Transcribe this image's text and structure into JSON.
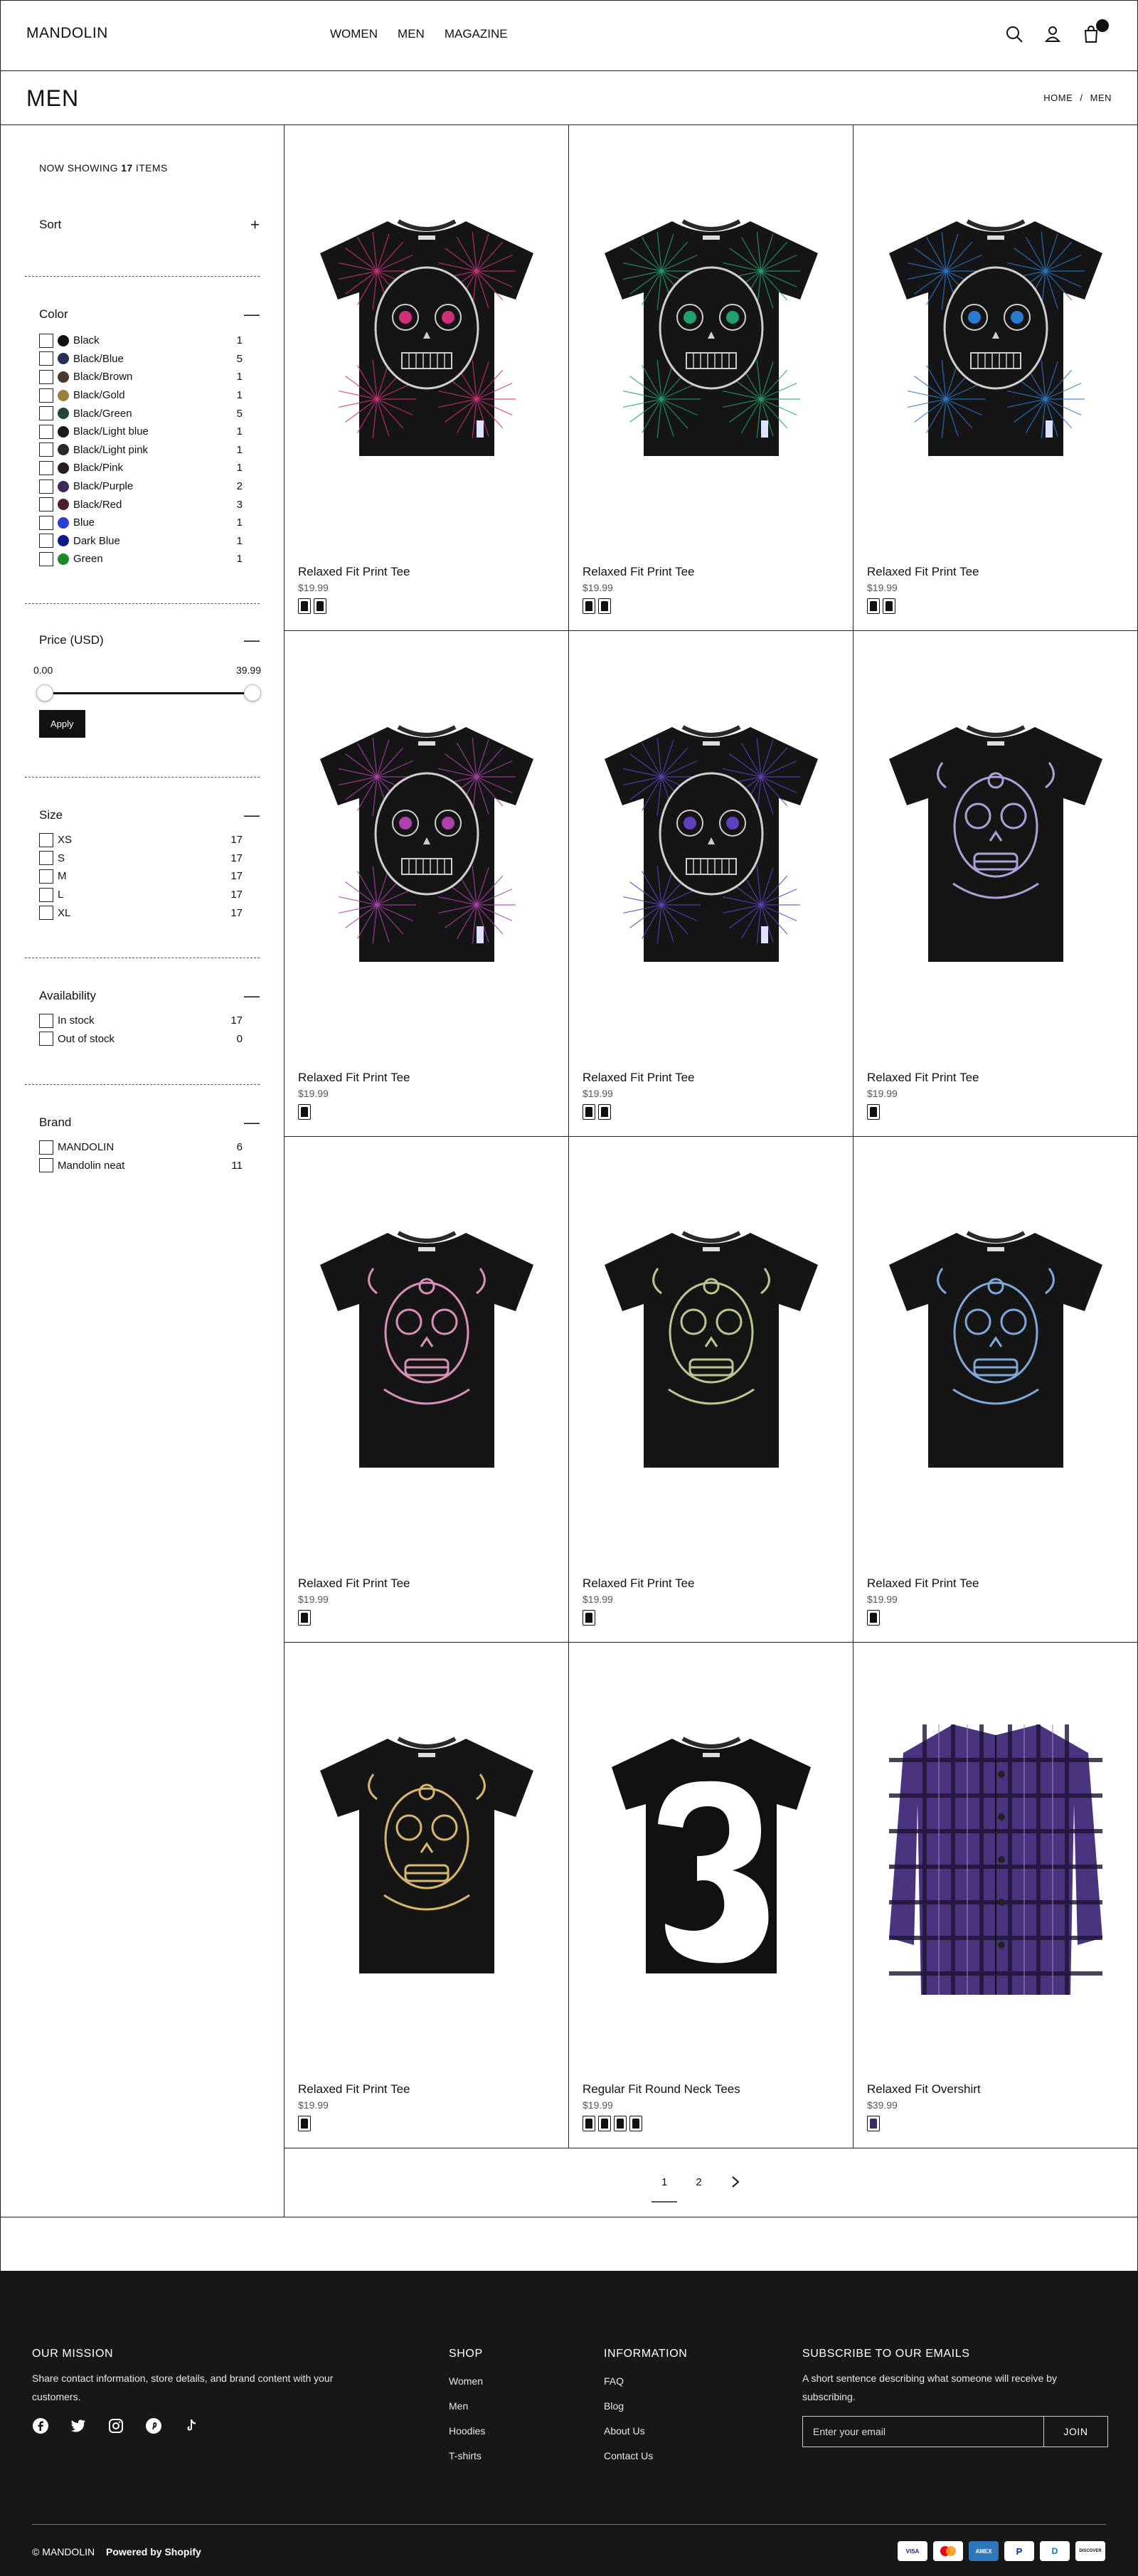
{
  "header": {
    "logo": "MANDOLIN",
    "nav": [
      "WOMEN",
      "MEN",
      "MAGAZINE"
    ]
  },
  "title_bar": {
    "title": "MEN",
    "breadcrumb": [
      "HOME",
      "/",
      "MEN"
    ]
  },
  "sidebar": {
    "showing_prefix": "NOW SHOWING",
    "showing_count": "17",
    "showing_suffix": "ITEMS",
    "sort_label": "Sort",
    "color": {
      "label": "Color",
      "options": [
        {
          "name": "Black",
          "count": "1",
          "swatch": "#111111"
        },
        {
          "name": "Black/Blue",
          "count": "5",
          "swatch": "#2a2f5a"
        },
        {
          "name": "Black/Brown",
          "count": "1",
          "swatch": "#4a3a2a"
        },
        {
          "name": "Black/Gold",
          "count": "1",
          "swatch": "#9a8040"
        },
        {
          "name": "Black/Green",
          "count": "5",
          "swatch": "#22463a"
        },
        {
          "name": "Black/Light blue",
          "count": "1",
          "swatch": "#1a1a1a"
        },
        {
          "name": "Black/Light pink",
          "count": "1",
          "swatch": "#2a2a2a"
        },
        {
          "name": "Black/Pink",
          "count": "1",
          "swatch": "#2a1a22"
        },
        {
          "name": "Black/Purple",
          "count": "2",
          "swatch": "#3a2a55"
        },
        {
          "name": "Black/Red",
          "count": "3",
          "swatch": "#4a2030"
        },
        {
          "name": "Blue",
          "count": "1",
          "swatch": "#2a3fd8"
        },
        {
          "name": "Dark Blue",
          "count": "1",
          "swatch": "#121a8a"
        },
        {
          "name": "Green",
          "count": "1",
          "swatch": "#1a8a2a"
        }
      ]
    },
    "price": {
      "label": "Price (USD)",
      "min": "0.00",
      "max": "39.99",
      "apply_label": "Apply"
    },
    "size": {
      "label": "Size",
      "options": [
        {
          "name": "XS",
          "count": "17"
        },
        {
          "name": "S",
          "count": "17"
        },
        {
          "name": "M",
          "count": "17"
        },
        {
          "name": "L",
          "count": "17"
        },
        {
          "name": "XL",
          "count": "17"
        }
      ]
    },
    "availability": {
      "label": "Availability",
      "options": [
        {
          "name": "In stock",
          "count": "17"
        },
        {
          "name": "Out of stock",
          "count": "0"
        }
      ]
    },
    "brand": {
      "label": "Brand",
      "options": [
        {
          "name": "MANDOLIN",
          "count": "6"
        },
        {
          "name": "Mandolin neat",
          "count": "11"
        }
      ]
    }
  },
  "products": [
    {
      "name": "Relaxed Fit Print Tee",
      "price": "$19.99",
      "swatches": 2,
      "style": "lines",
      "color": "#d0307a"
    },
    {
      "name": "Relaxed Fit Print Tee",
      "price": "$19.99",
      "swatches": 2,
      "style": "lines",
      "color": "#22a070"
    },
    {
      "name": "Relaxed Fit Print Tee",
      "price": "$19.99",
      "swatches": 2,
      "style": "lines",
      "color": "#2a7ad0"
    },
    {
      "name": "Relaxed Fit Print Tee",
      "price": "$19.99",
      "swatches": 1,
      "style": "lines",
      "color": "#b040b0"
    },
    {
      "name": "Relaxed Fit Print Tee",
      "price": "$19.99",
      "swatches": 2,
      "style": "lines",
      "color": "#6040c0"
    },
    {
      "name": "Relaxed Fit Print Tee",
      "price": "$19.99",
      "swatches": 1,
      "style": "skull",
      "color": "#b0a0d8"
    },
    {
      "name": "Relaxed Fit Print Tee",
      "price": "$19.99",
      "swatches": 1,
      "style": "skull",
      "color": "#d890b8"
    },
    {
      "name": "Relaxed Fit Print Tee",
      "price": "$19.99",
      "swatches": 1,
      "style": "skull",
      "color": "#b8c890"
    },
    {
      "name": "Relaxed Fit Print Tee",
      "price": "$19.99",
      "swatches": 1,
      "style": "skull",
      "color": "#80a8d8"
    },
    {
      "name": "Relaxed Fit Print Tee",
      "price": "$19.99",
      "swatches": 1,
      "style": "skull",
      "color": "#d8b870"
    },
    {
      "name": "Regular Fit Round Neck Tees",
      "price": "$19.99",
      "swatches": 4,
      "style": "three",
      "color": "#ffffff"
    },
    {
      "name": "Relaxed Fit Overshirt",
      "price": "$39.99",
      "swatches": 1,
      "style": "shirt",
      "color": "#4a3480"
    }
  ],
  "pagination": {
    "pages": [
      "1",
      "2"
    ],
    "next_icon": "chevron-right-icon"
  },
  "footer": {
    "mission": {
      "title": "OUR MISSION",
      "text": "Share contact information, store details, and brand content with your customers."
    },
    "shop": {
      "title": "SHOP",
      "links": [
        "Women",
        "Men",
        "Hoodies",
        "T-shirts"
      ]
    },
    "information": {
      "title": "INFORMATION",
      "links": [
        "FAQ",
        "Blog",
        "About Us",
        "Contact Us"
      ]
    },
    "subscribe": {
      "title": "SUBSCRIBE TO OUR EMAILS",
      "text": "A short sentence describing what someone will receive by subscribing.",
      "placeholder": "Enter your email",
      "button": "JOIN"
    },
    "copyright": "© MANDOLIN",
    "powered": "Powered by Shopify",
    "payments": [
      "VISA",
      "MC",
      "AMEX",
      "P",
      "D",
      "DISCOVER"
    ]
  }
}
